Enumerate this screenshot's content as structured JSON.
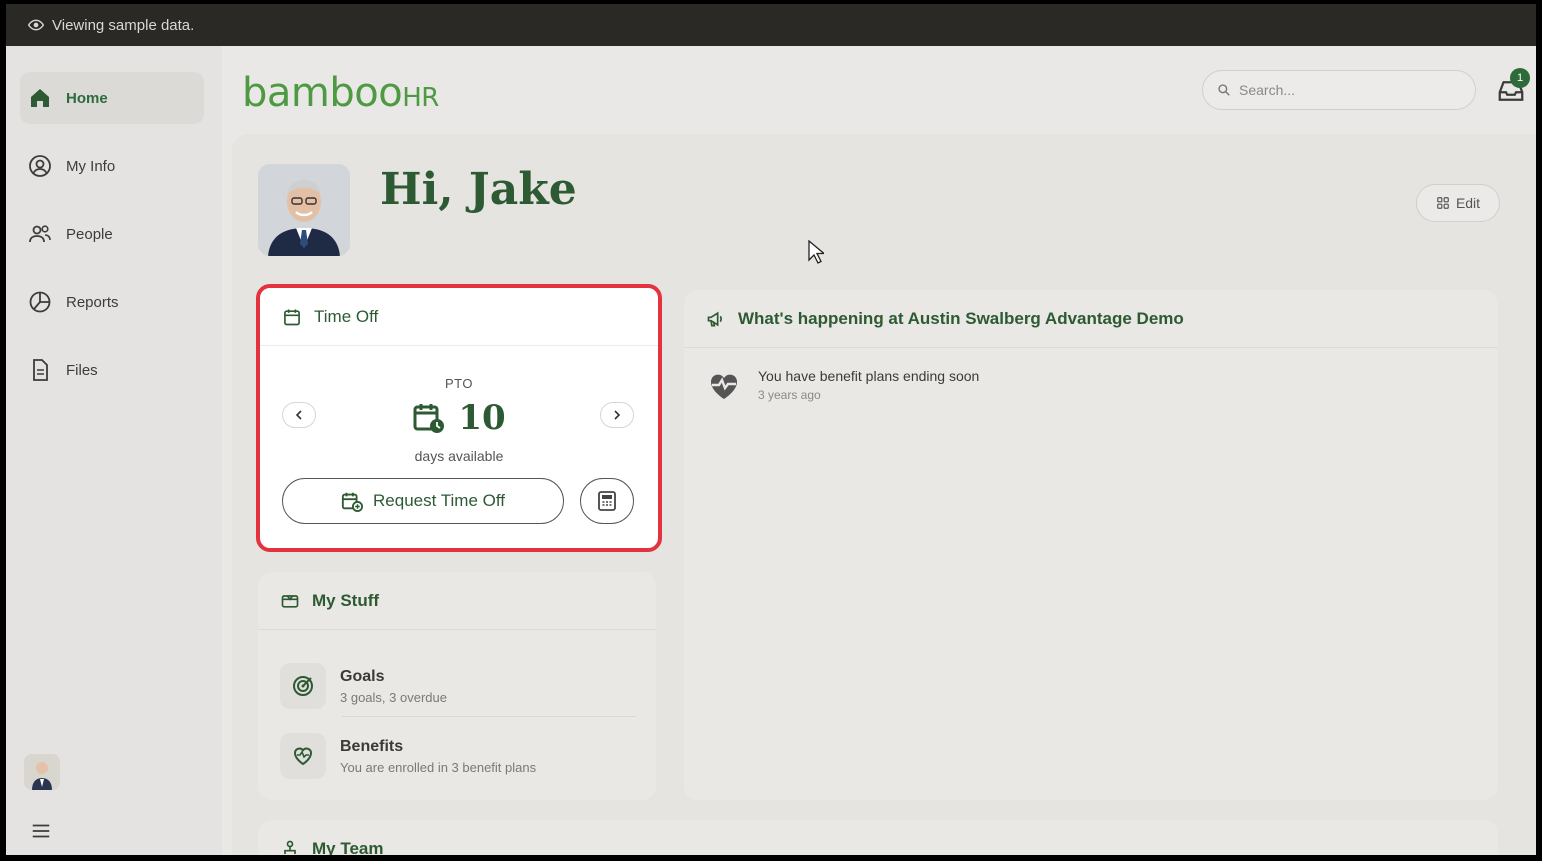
{
  "banner": {
    "text": "Viewing sample data."
  },
  "sidebar": {
    "items": [
      {
        "label": "Home",
        "icon": "home-icon"
      },
      {
        "label": "My Info",
        "icon": "user-circle-icon"
      },
      {
        "label": "People",
        "icon": "people-icon"
      },
      {
        "label": "Reports",
        "icon": "pie-chart-icon"
      },
      {
        "label": "Files",
        "icon": "file-icon"
      }
    ]
  },
  "header": {
    "logo_main": "bamboo",
    "logo_suffix": "HR",
    "search_placeholder": "Search...",
    "notification_count": "1"
  },
  "greeting": "Hi, Jake",
  "edit_label": "Edit",
  "time_off": {
    "title": "Time Off",
    "policy": "PTO",
    "value": "10",
    "unit_label": "days available",
    "request_label": "Request Time Off"
  },
  "my_stuff": {
    "title": "My Stuff",
    "items": [
      {
        "title": "Goals",
        "subtitle": "3 goals, 3 overdue",
        "icon": "target-icon"
      },
      {
        "title": "Benefits",
        "subtitle": "You are enrolled in 3 benefit plans",
        "icon": "heart-icon"
      }
    ]
  },
  "happening": {
    "title": "What's happening at Austin Swalberg Advantage Demo",
    "news": [
      {
        "title": "You have benefit plans ending soon",
        "time": "3 years ago",
        "icon": "heart-pulse-icon"
      }
    ]
  },
  "my_team": {
    "title": "My Team"
  },
  "colors": {
    "brand_green": "#2d5a33",
    "logo_green": "#4d9a43",
    "highlight_red": "#e2333f"
  }
}
